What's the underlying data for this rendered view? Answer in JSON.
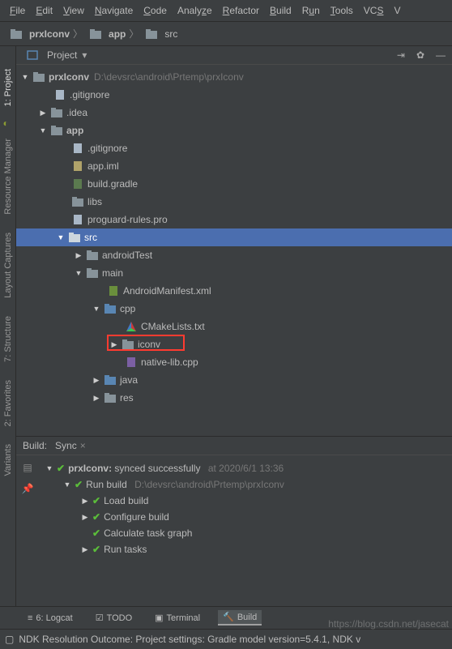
{
  "menu": [
    "File",
    "Edit",
    "View",
    "Navigate",
    "Code",
    "Analyze",
    "Refactor",
    "Build",
    "Run",
    "Tools",
    "VCS",
    "V"
  ],
  "breadcrumb": {
    "root": "prxIconv",
    "app": "app",
    "src": "src"
  },
  "projectPane": {
    "title": "Project",
    "rootName": "prxIconv",
    "rootPath": "D:\\devsrc\\android\\Prtemp\\prxIconv",
    "items": {
      "gitignore1": ".gitignore",
      "idea": ".idea",
      "app": "app",
      "gitignore2": ".gitignore",
      "appiml": "app.iml",
      "buildgradle": "build.gradle",
      "libs": "libs",
      "proguard": "proguard-rules.pro",
      "src": "src",
      "androidTest": "androidTest",
      "main": "main",
      "manifest": "AndroidManifest.xml",
      "cpp": "cpp",
      "cmake": "CMakeLists.txt",
      "iconv": "iconv",
      "nativelib": "native-lib.cpp",
      "java": "java",
      "res": "res"
    }
  },
  "sidebarLeft": {
    "project": "1: Project",
    "resmgr": "Resource Manager",
    "layout": "Layout Captures",
    "structure": "7: Structure",
    "favorites": "2: Favorites",
    "variants": "Variants"
  },
  "buildPane": {
    "headerLabel": "Build:",
    "syncTab": "Sync",
    "root": "prxIconv:",
    "rootMsg": "synced successfully",
    "rootTime": "at 2020/6/1 13:36",
    "runBuild": "Run build",
    "runBuildPath": "D:\\devsrc\\android\\Prtemp\\prxIconv",
    "loadBuild": "Load build",
    "configure": "Configure build",
    "calc": "Calculate task graph",
    "runTasks": "Run tasks"
  },
  "footer": {
    "logcat": "6: Logcat",
    "todo": "TODO",
    "terminal": "Terminal",
    "build": "Build"
  },
  "statusbar": {
    "text": "NDK Resolution Outcome: Project settings: Gradle model version=5.4.1, NDK v"
  },
  "watermark": "https://blog.csdn.net/jasecat"
}
